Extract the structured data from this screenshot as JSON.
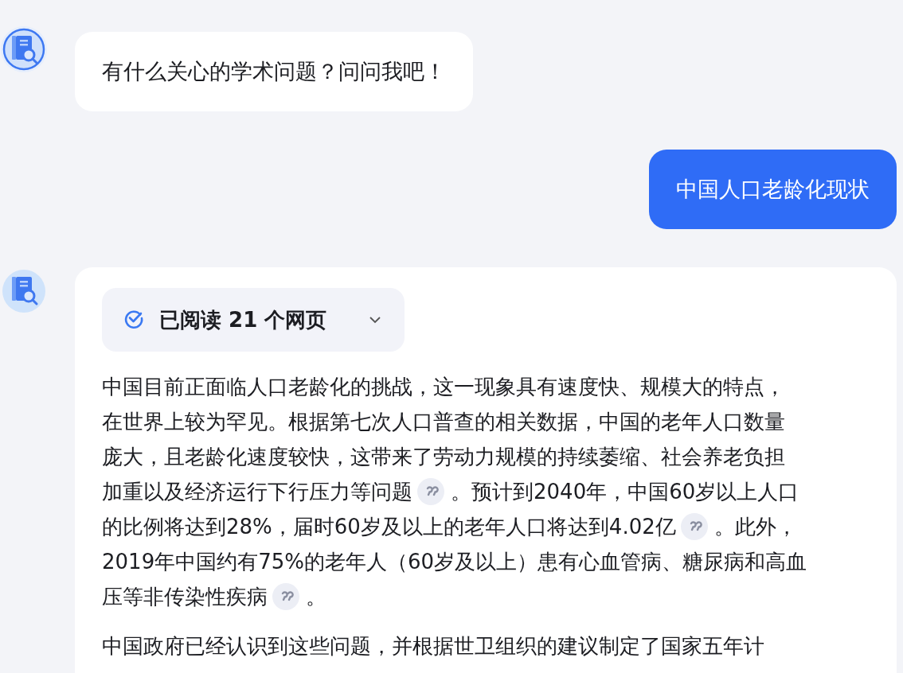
{
  "messages": [
    {
      "kind": "greeting",
      "text": "有什么关心的学术问题？问问我吧！"
    },
    {
      "kind": "question",
      "text": "中国人口老龄化现状"
    },
    {
      "kind": "answer",
      "sources": {
        "label": "已阅读 21 个网页",
        "expanded": false
      },
      "paragraphs": [
        {
          "lines": [
            [
              {
                "kind": "text",
                "text": "中国目前正面临人口老龄化的挑战，这一现象具有速度快、规模大的特点，"
              }
            ],
            [
              {
                "kind": "text",
                "text": "在世界上较为罕见。根据第七次人口普查的相关数据，中国的老年人口数量"
              }
            ],
            [
              {
                "kind": "text",
                "text": "庞大，且老龄化速度较快，这带来了劳动力规模的持续萎缩、社会养老负担"
              }
            ],
            [
              {
                "kind": "text",
                "text": "加重以及经济运行下行压力等问题"
              },
              {
                "kind": "citation"
              },
              {
                "kind": "text",
                "text": "。预计到2040年，中国60岁以上人口"
              }
            ],
            [
              {
                "kind": "text",
                "text": "的比例将达到28%，届时60岁及以上的老年人口将达到4.02亿"
              },
              {
                "kind": "citation"
              },
              {
                "kind": "text",
                "text": "。此外，"
              }
            ],
            [
              {
                "kind": "text",
                "text": "2019年中国约有75%的老年人（60岁及以上）患有心血管病、糖尿病和高血"
              }
            ],
            [
              {
                "kind": "text",
                "text": "压等非传染性疾病"
              },
              {
                "kind": "citation"
              },
              {
                "kind": "text",
                "text": "。"
              }
            ]
          ]
        },
        {
          "lines": [
            [
              {
                "kind": "text",
                "text": "中国政府已经认识到这些问题，并根据世卫组织的建议制定了国家五年计"
              }
            ]
          ]
        }
      ]
    }
  ]
}
